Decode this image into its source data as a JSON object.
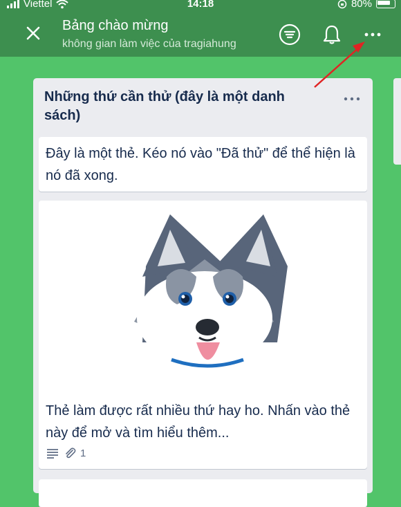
{
  "status_bar": {
    "carrier": "Viettel",
    "time": "14:18",
    "battery": "80%"
  },
  "header": {
    "title": "Bảng chào mừng",
    "subtitle": "không gian làm việc của tragiahung"
  },
  "list": {
    "title": "Những thứ cần thử (đây là một danh sách)",
    "cards": [
      {
        "text": "Đây là một thẻ. Kéo nó vào \"Đã thử\" để thể hiện là nó đã xong."
      },
      {
        "text": "Thẻ làm được rất nhiều thứ hay ho. Nhấn vào thẻ này để mở và tìm hiểu thêm...",
        "attachments_count": "1"
      }
    ]
  },
  "colors": {
    "header": "#3d8f4f",
    "board_background": "#52c46a",
    "list_background": "#ebecf0",
    "annotation_arrow": "#e02424"
  },
  "icons": [
    "signal-icon",
    "wifi-icon",
    "lock-rotation-icon",
    "battery-icon",
    "close-icon",
    "filter-icon",
    "bell-icon",
    "more-icon",
    "description-icon",
    "attachment-icon"
  ]
}
